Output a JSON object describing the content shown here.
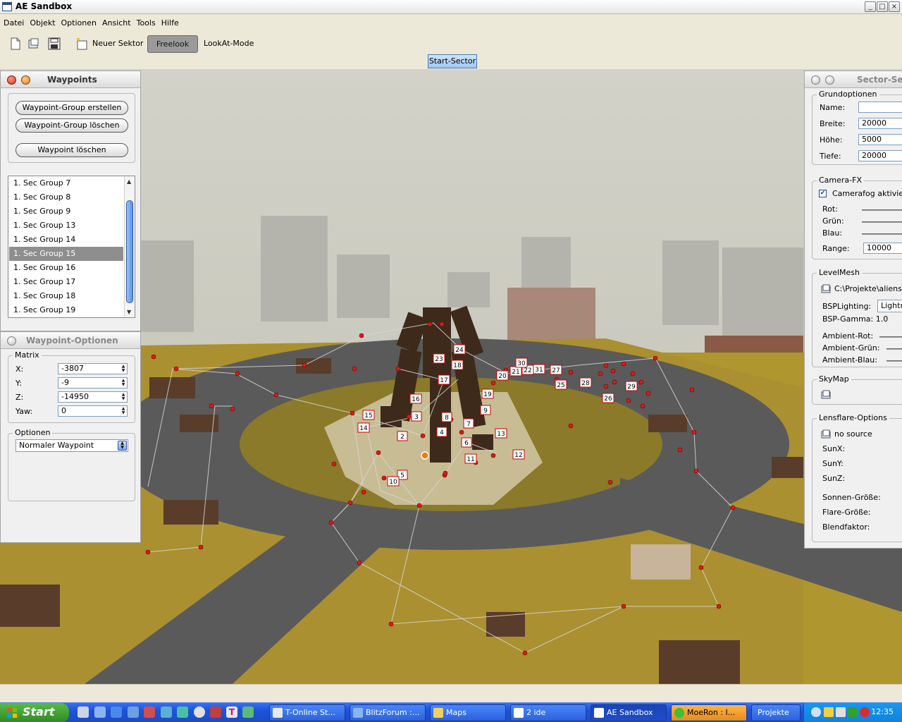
{
  "window": {
    "title": "AE Sandbox"
  },
  "menu": [
    "Datei",
    "Objekt",
    "Optionen",
    "Ansicht",
    "Tools",
    "Hilfe"
  ],
  "toolbar": {
    "new_sector": "Neuer Sektor",
    "freelook": "Freelook",
    "lookat": "LookAt-Mode"
  },
  "tab": "Start-Sector",
  "waypoints_panel": {
    "title": "Waypoints",
    "buttons": [
      "Waypoint-Group erstellen",
      "Waypoint-Group löschen",
      "Waypoint löschen"
    ],
    "groups": [
      "1. Sec Group 7",
      "1. Sec Group 8",
      "1. Sec Group 9",
      "1. Sec Group 13",
      "1. Sec Group 14",
      "1. Sec Group 15",
      "1. Sec Group 16",
      "1. Sec Group 17",
      "1. Sec Group 18",
      "1. Sec Group 19"
    ],
    "selected_index": 5
  },
  "waypoint_options": {
    "title": "Waypoint-Optionen",
    "matrix_label": "Matrix",
    "fields": [
      {
        "label": "X:",
        "value": "-3807"
      },
      {
        "label": "Y:",
        "value": "-9"
      },
      {
        "label": "Z:",
        "value": "-14950"
      },
      {
        "label": "Yaw:",
        "value": "0"
      }
    ],
    "options_label": "Optionen",
    "type_value": "Normaler Waypoint"
  },
  "sector_panel": {
    "title": "Sector-Se",
    "basic": {
      "label": "Grundoptionen",
      "name_label": "Name:",
      "name_value": "",
      "width_label": "Breite:",
      "width_value": "20000",
      "height_label": "Höhe:",
      "height_value": "5000",
      "depth_label": "Tiefe:",
      "depth_value": "20000"
    },
    "camera": {
      "label": "Camera-FX",
      "fog_label": "Camerafog aktiviert",
      "fog_checked": true,
      "red": "Rot:",
      "green": "Grün:",
      "blue": "Blau:",
      "range_label": "Range:",
      "range_value": "10000"
    },
    "levelmesh": {
      "label": "LevelMesh",
      "path": "C:\\Projekte\\aliens e",
      "bsp_label": "BSPLighting:",
      "bsp_value": "Lightma",
      "gamma": "BSP-Gamma: 1.0",
      "ambient_red": "Ambient-Rot:",
      "ambient_green": "Ambient-Grün:",
      "ambient_blue": "Ambient-Blau:"
    },
    "skymap": {
      "label": "SkyMap"
    },
    "lensflare": {
      "label": "Lensflare-Options",
      "source": "no source",
      "sunx": "SunX:",
      "suny": "SunY:",
      "sunz": "SunZ:",
      "sun_size": "Sonnen-Größe:",
      "flare_size": "Flare-Größe:",
      "blend": "Blendfaktor:"
    }
  },
  "waypoint_labels": [
    "2",
    "3",
    "4",
    "5",
    "6",
    "7",
    "8",
    "9",
    "10",
    "11",
    "12",
    "13",
    "14",
    "15",
    "16",
    "17",
    "18",
    "19",
    "20",
    "21",
    "22",
    "23",
    "24",
    "25",
    "26",
    "27",
    "28",
    "29",
    "30",
    "31"
  ],
  "taskbar": {
    "start": "Start",
    "tasks": [
      "T-Online St...",
      "BlitzForum :...",
      "Maps",
      "2 ide",
      "AE Sandbox",
      "MoeRon : I...",
      "Projekte"
    ],
    "clock": "12:35"
  }
}
